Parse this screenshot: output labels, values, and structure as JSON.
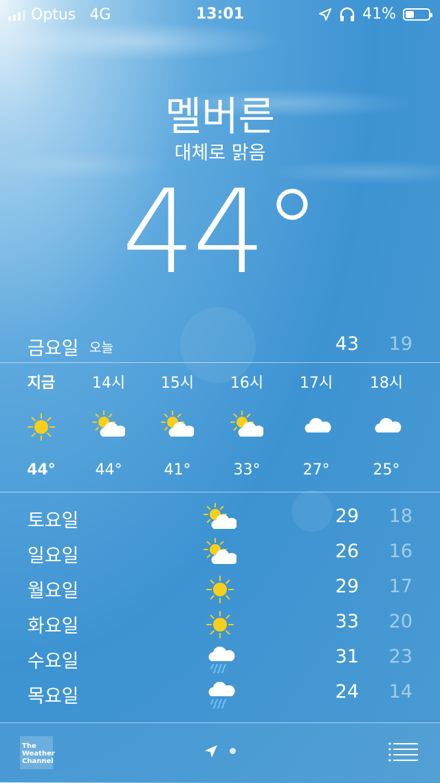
{
  "status_bar": {
    "carrier": "Optus",
    "network": "4G",
    "time": "13:01",
    "battery": "41%",
    "battery_level": 0.41,
    "icons": [
      "signal-icon",
      "location-arrow-icon",
      "headphones-icon",
      "battery-icon"
    ]
  },
  "location": {
    "city": "멜버른",
    "condition": "대체로 맑음",
    "current_temp": "44°"
  },
  "today": {
    "day": "금요일",
    "label": "오늘",
    "high": "43",
    "low": "19"
  },
  "hourly": [
    {
      "time": "지금",
      "icon": "sun-icon",
      "temp": "44°"
    },
    {
      "time": "14시",
      "icon": "partly-cloudy-icon",
      "temp": "44°"
    },
    {
      "time": "15시",
      "icon": "partly-cloudy-icon",
      "temp": "41°"
    },
    {
      "time": "16시",
      "icon": "partly-cloudy-icon",
      "temp": "33°"
    },
    {
      "time": "17시",
      "icon": "cloud-icon",
      "temp": "27°"
    },
    {
      "time": "18시",
      "icon": "cloud-icon",
      "temp": "25°"
    }
  ],
  "daily": [
    {
      "day": "토요일",
      "icon": "partly-cloudy-icon",
      "high": "29",
      "low": "18"
    },
    {
      "day": "일요일",
      "icon": "partly-cloudy-icon",
      "high": "26",
      "low": "16"
    },
    {
      "day": "월요일",
      "icon": "sun-icon",
      "high": "29",
      "low": "17"
    },
    {
      "day": "화요일",
      "icon": "sun-icon",
      "high": "33",
      "low": "20"
    },
    {
      "day": "수요일",
      "icon": "rain-icon",
      "high": "31",
      "low": "23"
    },
    {
      "day": "목요일",
      "icon": "rain-icon",
      "high": "24",
      "low": "14"
    }
  ],
  "bottom_bar": {
    "logo_text": "The Weather Channel",
    "icons": [
      "weather-channel-logo",
      "location-arrow-icon",
      "page-dot",
      "list-icon"
    ]
  },
  "colors": {
    "sky_top": "#a6d1ee",
    "sky_mid": "#3d93d2",
    "sun": "#f7cf1a",
    "rain": "#6fc3f2"
  }
}
